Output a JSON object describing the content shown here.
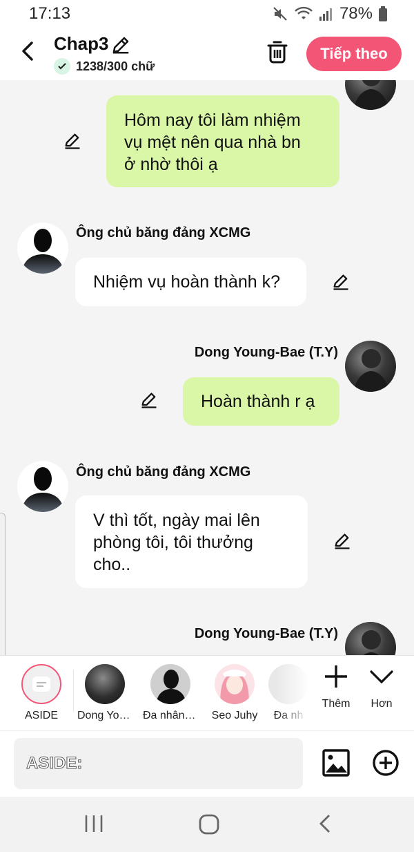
{
  "status": {
    "time": "17:13",
    "battery": "78%"
  },
  "header": {
    "title": "Chap3",
    "word_count": "1238/300 chữ",
    "next_label": "Tiếp theo"
  },
  "messages": [
    {
      "side": "right",
      "text_lines": [
        "Hôm nay tôi làm nhiệm",
        "vụ mệt nên qua nhà bn",
        "ở nhờ thôi ạ"
      ]
    },
    {
      "side": "left",
      "speaker": "Ông chủ băng đảng XCMG",
      "text": "Nhiệm vụ hoàn thành k?"
    },
    {
      "side": "right",
      "speaker": "Dong Young-Bae (T.Y)",
      "text": "Hoàn thành r ạ"
    },
    {
      "side": "left",
      "speaker": "Ông chủ băng đảng XCMG",
      "text_lines": [
        "V thì tốt, ngày mai lên",
        "phòng tôi, tôi thưởng",
        "cho.."
      ]
    },
    {
      "side": "right",
      "speaker": "Dong Young-Bae (T.Y)"
    }
  ],
  "characters": [
    {
      "label": "ASIDE"
    },
    {
      "label": "Dong You..."
    },
    {
      "label": "Đa nhân v..."
    },
    {
      "label": "Seo Juhy"
    },
    {
      "label": "Đa nh"
    }
  ],
  "actions": {
    "add_label": "Thêm",
    "more_label": "Hơn"
  },
  "input": {
    "placeholder": "ASIDE:"
  },
  "colors": {
    "accent": "#f25576",
    "green_bubble": "#d9f7a6",
    "background": "#f4f4f4"
  }
}
